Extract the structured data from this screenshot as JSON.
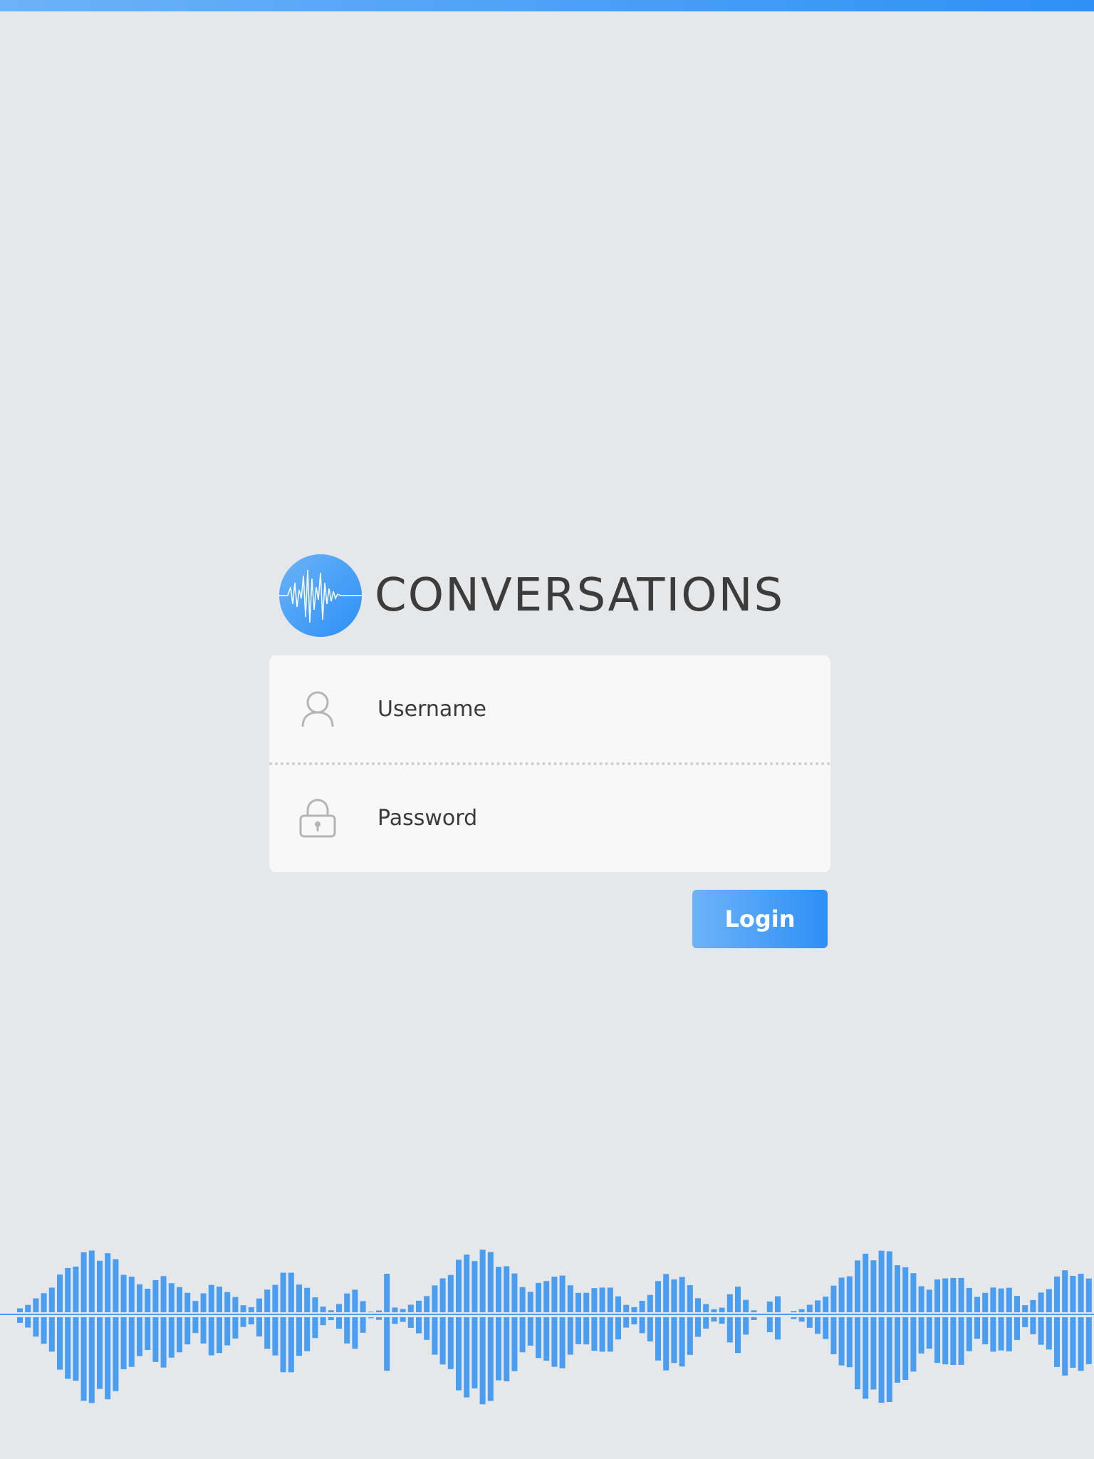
{
  "app": {
    "title": "CONVERSATIONS",
    "logo_icon": "waveform-logo-icon"
  },
  "login_form": {
    "username": {
      "placeholder": "Username",
      "value": "",
      "icon": "user-icon"
    },
    "password": {
      "placeholder": "Password",
      "value": "",
      "icon": "lock-icon"
    },
    "login_label": "Login"
  },
  "colors": {
    "background": "#e6e7e9",
    "accent_light": "#6cb3f8",
    "accent_dark": "#2e8ff6",
    "waveform": "#4a9ef2",
    "card": "#f8f8f8",
    "title_text": "#3c3c3c"
  },
  "decoration": {
    "waveform_icon": "audio-waveform-graphic"
  }
}
